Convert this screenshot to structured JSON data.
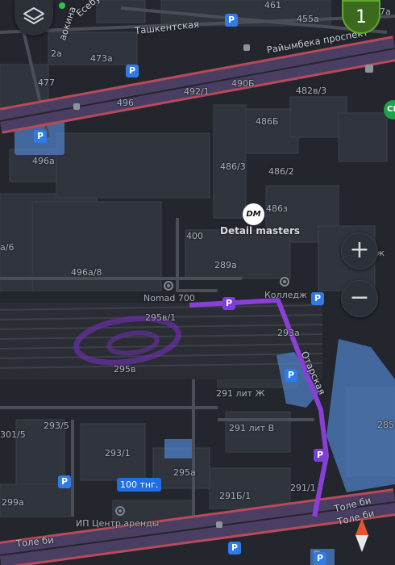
{
  "streets": {
    "tashkentskaya": "Ташкентская",
    "raiymbek": "Райымбека проспект",
    "otarskaya": "Отарская",
    "tole_bi_1": "Толе би",
    "tole_bi_2": "Толе би",
    "tole_bi_3": "Толе би",
    "esebul": "Есебу",
    "saryarka": "аокина"
  },
  "buildings": {
    "b461": "461",
    "b455a": "455а",
    "b47a": "47а",
    "b2a": "2а",
    "b473a": "473а",
    "b477": "477",
    "b496": "496",
    "b492_1": "492/1",
    "b490b": "490Б",
    "b482v_3": "482в/3",
    "b486b": "486Б",
    "b496a": "496а",
    "b486_3": "486/3",
    "b486_2": "486/2",
    "b486z": "486з",
    "b400": "400",
    "b289a": "289а",
    "b496a_8": "496а/8",
    "b6": "а/6",
    "b295v_1": "295в/1",
    "b293a": "293а",
    "b295v": "295в",
    "b291lit_zh": "291 лит Ж",
    "b293_5": "293/5",
    "b301_5": "301/5",
    "b291lit_v": "291 лит В",
    "b293_1": "293/1",
    "b285": "285",
    "b295a": "295а",
    "b299a": "299а",
    "b291b_1": "291Б/1",
    "b291_1": "291/1"
  },
  "pois": {
    "detail_masters": "Detail masters",
    "detail_logo": "DM",
    "nomad": "Nomad 700",
    "college_1": "Колледж",
    "college_2": "Колледж",
    "ip_center": "ИП Центр аренды",
    "cd_badge": "CD"
  },
  "parking": {
    "label": "P"
  },
  "price_tag": "100 тнг.",
  "controls": {
    "zone_number": "1",
    "zoom_in": "+",
    "zoom_out": "−"
  },
  "colors": {
    "background": "#23262d",
    "road_main": "#b84a5a",
    "road_fill": "#4a3f63",
    "route": "#8a3fd6",
    "parking_blue": "#2f7bea",
    "parking_area": "#5b8fd8",
    "building": "#30343c",
    "accent_green": "#5fa62d"
  },
  "icons": {
    "layers": "layers-icon",
    "compass": "compass-icon",
    "pin": "place-pin-icon",
    "parking": "parking-icon"
  }
}
